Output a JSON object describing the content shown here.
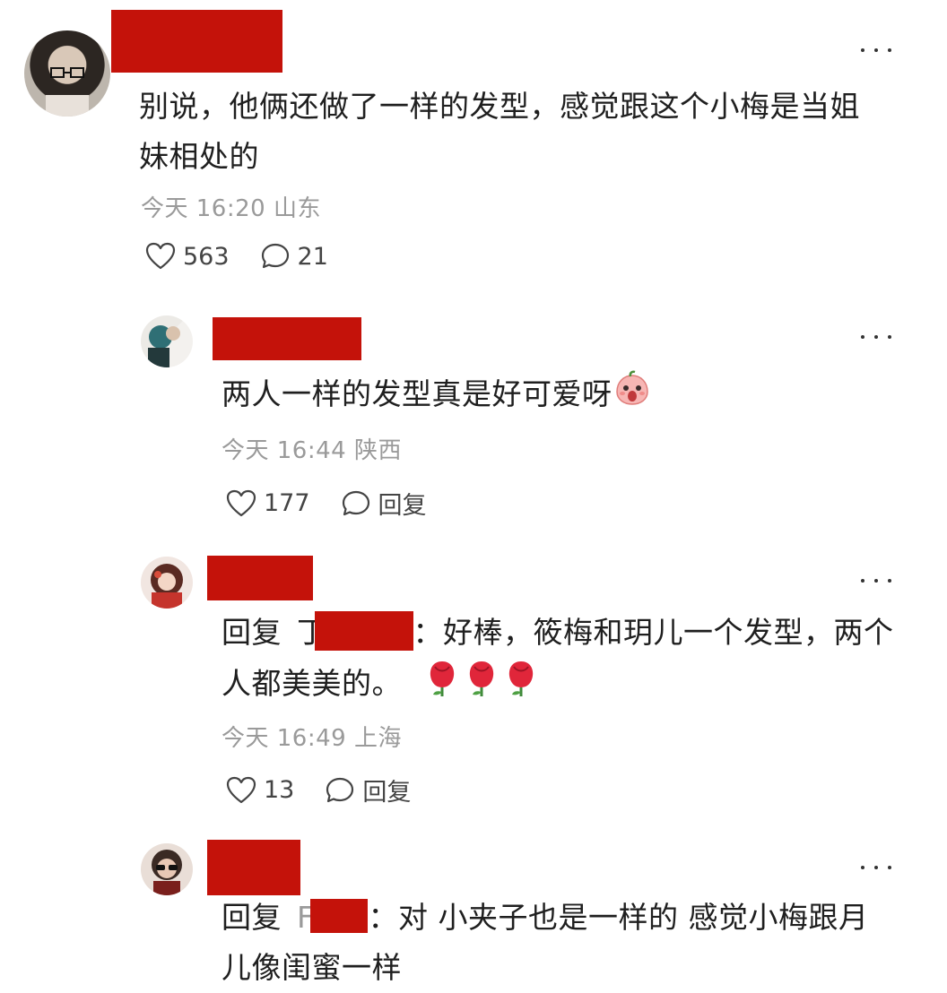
{
  "comments": [
    {
      "text_line1": "别说，他俩还做了一样的发型，感觉跟这个小梅是当姐",
      "text_line2": "妹相处的",
      "time": "今天 16:20",
      "location": "山东",
      "likes": "563",
      "replies": "21"
    },
    {
      "text": "两人一样的发型真是好可爱呀",
      "emoji_icon": "surprised-peach-emoji",
      "time": "今天 16:44",
      "location": "陕西",
      "likes": "177",
      "reply_label": "回复"
    },
    {
      "reply_prefix": "回复",
      "reply_prefix_tail": "丁",
      "text_line1": "：好棒，筱梅和玥儿一个发型，两个",
      "text_line2": "人都美美的。",
      "emoji_icon": "rose-emoji",
      "time": "今天 16:49",
      "location": "上海",
      "likes": "13",
      "reply_label": "回复"
    },
    {
      "reply_prefix": "回复",
      "reply_prefix_tail": "F",
      "text_line1": "：对 小夹子也是一样的 感觉小梅跟月",
      "text_line2": "儿像闺蜜一样"
    }
  ],
  "colors": {
    "redaction": "#c4120a",
    "meta_text": "#9a9a9a",
    "body_text": "#1f1f1f"
  },
  "icons": {
    "like": "heart-outline-icon",
    "reply": "speech-bubble-icon",
    "more": "more-dots-icon"
  }
}
